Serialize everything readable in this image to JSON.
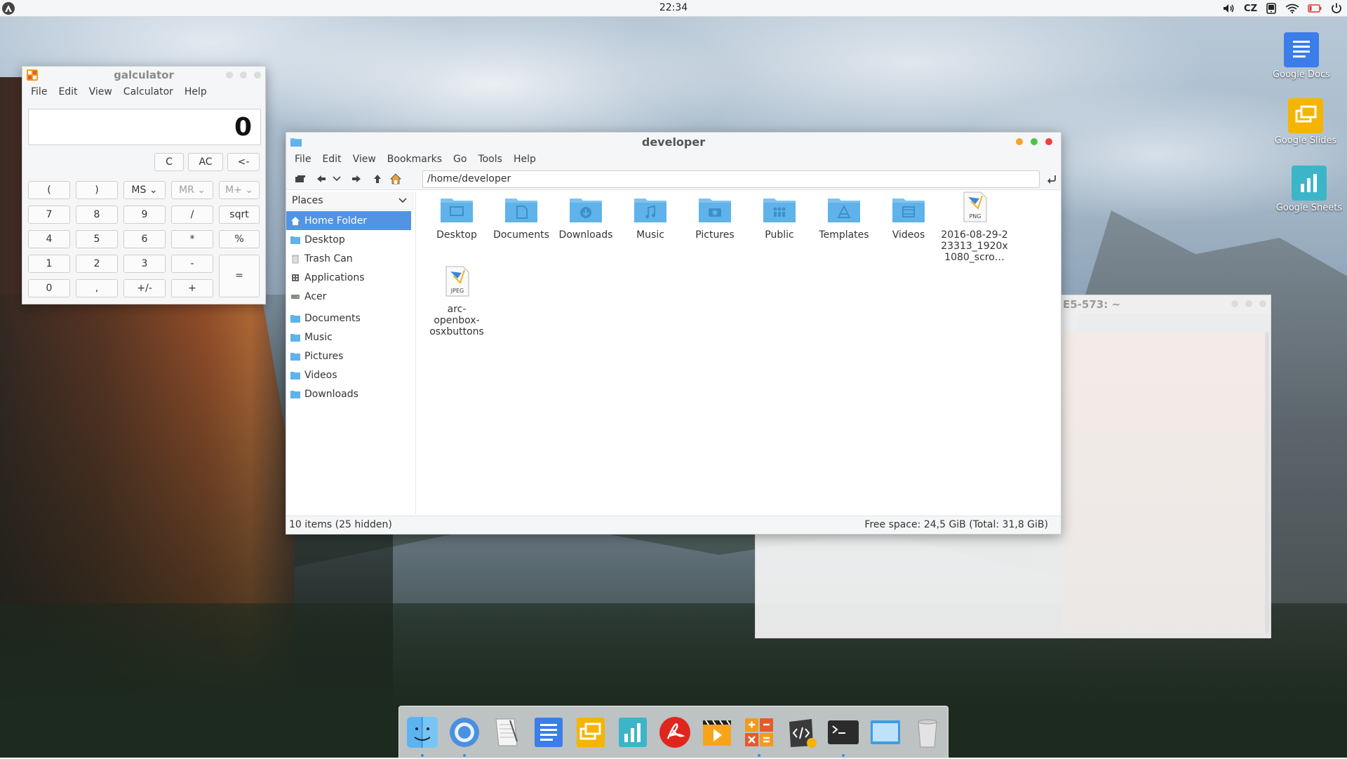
{
  "top_panel": {
    "clock": "22:34",
    "keyboard_layout": "CZ"
  },
  "desktop_icons": [
    {
      "label": "Google Docs",
      "color": "#3b7de9"
    },
    {
      "label": "Google Slides",
      "color": "#f5b400"
    },
    {
      "label": "Google Sheets",
      "color": "#3db5c9"
    }
  ],
  "calculator": {
    "title": "galculator",
    "menu": [
      "File",
      "Edit",
      "View",
      "Calculator",
      "Help"
    ],
    "display": "0",
    "top_buttons": [
      "C",
      "AC",
      "<-"
    ],
    "memory_row": [
      "(",
      ")",
      "MS",
      "MR",
      "M+"
    ],
    "rows": [
      [
        "7",
        "8",
        "9",
        "/",
        "sqrt"
      ],
      [
        "4",
        "5",
        "6",
        "*",
        "%"
      ],
      [
        "1",
        "2",
        "3",
        "-"
      ],
      [
        "0",
        ",",
        "+/-",
        "+"
      ]
    ],
    "equals": "="
  },
  "file_manager": {
    "title": "developer",
    "menu": [
      "File",
      "Edit",
      "View",
      "Bookmarks",
      "Go",
      "Tools",
      "Help"
    ],
    "path": "/home/developer",
    "places_header": "Places",
    "places": [
      {
        "label": "Home Folder",
        "icon": "home-icon",
        "selected": true
      },
      {
        "label": "Desktop",
        "icon": "folder-icon"
      },
      {
        "label": "Trash Can",
        "icon": "trash-icon"
      },
      {
        "label": "Applications",
        "icon": "applications-icon"
      },
      {
        "label": "Acer",
        "icon": "drive-icon"
      }
    ],
    "bookmarks": [
      {
        "label": "Documents"
      },
      {
        "label": "Music"
      },
      {
        "label": "Pictures"
      },
      {
        "label": "Videos"
      },
      {
        "label": "Downloads"
      }
    ],
    "files": [
      {
        "name": "Desktop",
        "type": "folder",
        "icon": "desktop"
      },
      {
        "name": "Documents",
        "type": "folder",
        "icon": "documents"
      },
      {
        "name": "Downloads",
        "type": "folder",
        "icon": "downloads"
      },
      {
        "name": "Music",
        "type": "folder",
        "icon": "music"
      },
      {
        "name": "Pictures",
        "type": "folder",
        "icon": "pictures"
      },
      {
        "name": "Public",
        "type": "folder",
        "icon": "public"
      },
      {
        "name": "Templates",
        "type": "folder",
        "icon": "templates"
      },
      {
        "name": "Videos",
        "type": "folder",
        "icon": "videos"
      },
      {
        "name": "2016-08-29-2 23313_1920x 1080_scro…",
        "type": "image",
        "badge": "PNG"
      },
      {
        "name": "arc- openbox- osxbuttons",
        "type": "image",
        "badge": "JPEG"
      }
    ],
    "status_left": "10 items (25 hidden)",
    "status_right": "Free space: 24,5 GiB (Total: 31,8 GiB)"
  },
  "terminal": {
    "title": "E5-573: ~"
  },
  "dock": {
    "items": [
      {
        "name": "finder",
        "running": true
      },
      {
        "name": "chromium",
        "running": true
      },
      {
        "name": "text-editor",
        "running": false
      },
      {
        "name": "docs",
        "running": false
      },
      {
        "name": "slides",
        "running": false
      },
      {
        "name": "sheets",
        "running": false
      },
      {
        "name": "pdf-reader",
        "running": false
      },
      {
        "name": "video-player",
        "running": false
      },
      {
        "name": "calculator",
        "running": true
      },
      {
        "name": "code-editor",
        "running": false
      },
      {
        "name": "terminal",
        "running": true
      },
      {
        "name": "window",
        "running": false
      },
      {
        "name": "trash",
        "running": false
      }
    ]
  }
}
